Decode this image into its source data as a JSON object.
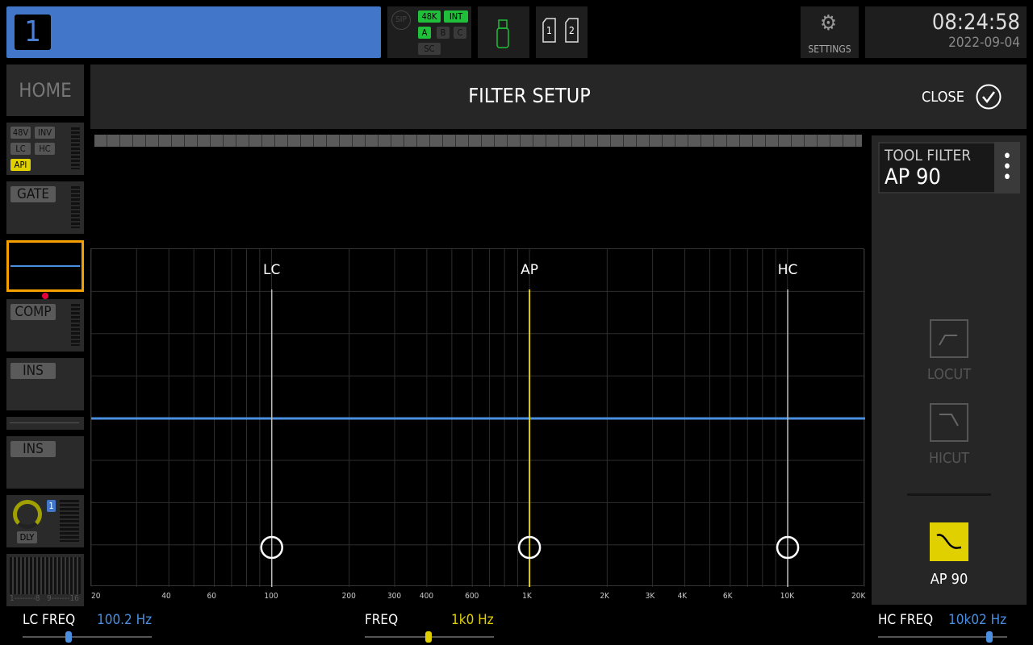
{
  "topbar": {
    "channel_number": "1",
    "channel_color": "#4176c9",
    "status": {
      "sip": "SIP",
      "rate": "48K",
      "clock": "INT",
      "a": "A",
      "b": "B",
      "c": "C",
      "sc": "SC"
    },
    "usb_icon": "usb-drive-icon",
    "sd_cards": [
      "1",
      "2"
    ],
    "settings_label": "SETTINGS",
    "time": "08:24:58",
    "date": "2022-09-04"
  },
  "sidebar": {
    "home": "HOME",
    "input_tags": [
      "48V",
      "INV",
      "LC",
      "HC",
      "API"
    ],
    "gate": "GATE",
    "comp": "COMP",
    "ins1": "INS",
    "ins2": "INS",
    "dly": "DLY",
    "dly_slot": "1",
    "bus_left": "1--------8",
    "bus_right": "9-------16"
  },
  "header": {
    "title": "FILTER SETUP",
    "close_label": "CLOSE"
  },
  "graph": {
    "x_range_hz": [
      20,
      20000
    ],
    "x_scale": "log",
    "x_ticks": [
      {
        "f": 20,
        "l": "20"
      },
      {
        "f": 40,
        "l": "40"
      },
      {
        "f": 60,
        "l": "60"
      },
      {
        "f": 100,
        "l": "100"
      },
      {
        "f": 200,
        "l": "200"
      },
      {
        "f": 300,
        "l": "300"
      },
      {
        "f": 400,
        "l": "400"
      },
      {
        "f": 600,
        "l": "600"
      },
      {
        "f": 1000,
        "l": "1K"
      },
      {
        "f": 2000,
        "l": "2K"
      },
      {
        "f": 3000,
        "l": "3K"
      },
      {
        "f": 4000,
        "l": "4K"
      },
      {
        "f": 6000,
        "l": "6K"
      },
      {
        "f": 10000,
        "l": "10K"
      },
      {
        "f": 20000,
        "l": "20K"
      }
    ],
    "markers": [
      {
        "label": "LC",
        "freq": 100.2,
        "color": "#bbbbbb"
      },
      {
        "label": "AP",
        "freq": 1000,
        "color": "#e0d000"
      },
      {
        "label": "HC",
        "freq": 10020,
        "color": "#bbbbbb"
      }
    ],
    "response_color": "#4a8fe0"
  },
  "tool": {
    "title": "TOOL FILTER",
    "value": "AP 90",
    "options": [
      {
        "label": "LOCUT",
        "icon": "locut-icon",
        "active": false
      },
      {
        "label": "HICUT",
        "icon": "hicut-icon",
        "active": false
      },
      {
        "label": "AP 90",
        "icon": "allpass-icon",
        "active": true
      }
    ],
    "accent": "#e0d000"
  },
  "params": {
    "lc": {
      "label": "LC FREQ",
      "value": "100.2 Hz",
      "color": "#4a8fe0"
    },
    "freq": {
      "label": "FREQ",
      "value": "1k0 Hz",
      "color": "#e0d000"
    },
    "hc": {
      "label": "HC FREQ",
      "value": "10k02 Hz",
      "color": "#4a8fe0"
    }
  }
}
